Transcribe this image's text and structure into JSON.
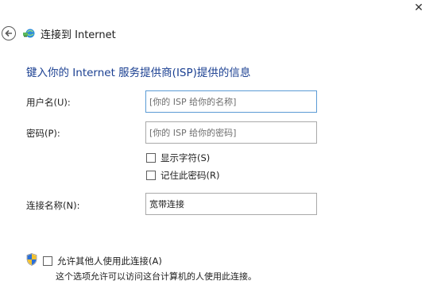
{
  "window": {
    "close_glyph": "✕"
  },
  "header": {
    "back_icon": "back-arrow-icon",
    "network_icon": "network-connection-icon",
    "title": "连接到 Internet"
  },
  "form": {
    "instruction": "键入你的 Internet 服务提供商(ISP)提供的信息",
    "username": {
      "label": "用户名(U):",
      "value": "",
      "placeholder": "[你的 ISP 给你的名称]"
    },
    "password": {
      "label": "密码(P):",
      "value": "",
      "placeholder": "[你的 ISP 给你的密码]"
    },
    "show_chars": {
      "label": "显示字符(S)",
      "checked": false
    },
    "remember_password": {
      "label": "记住此密码(R)",
      "checked": false
    },
    "connection_name": {
      "label": "连接名称(N):",
      "value": "宽带连接"
    },
    "allow_others": {
      "label": "允许其他人使用此连接(A)",
      "checked": false,
      "helper": "这个选项允许可以访问这台计算机的人使用此连接。"
    }
  },
  "colors": {
    "accent": "#1a3f91",
    "focus_border": "#5b9bd5"
  }
}
